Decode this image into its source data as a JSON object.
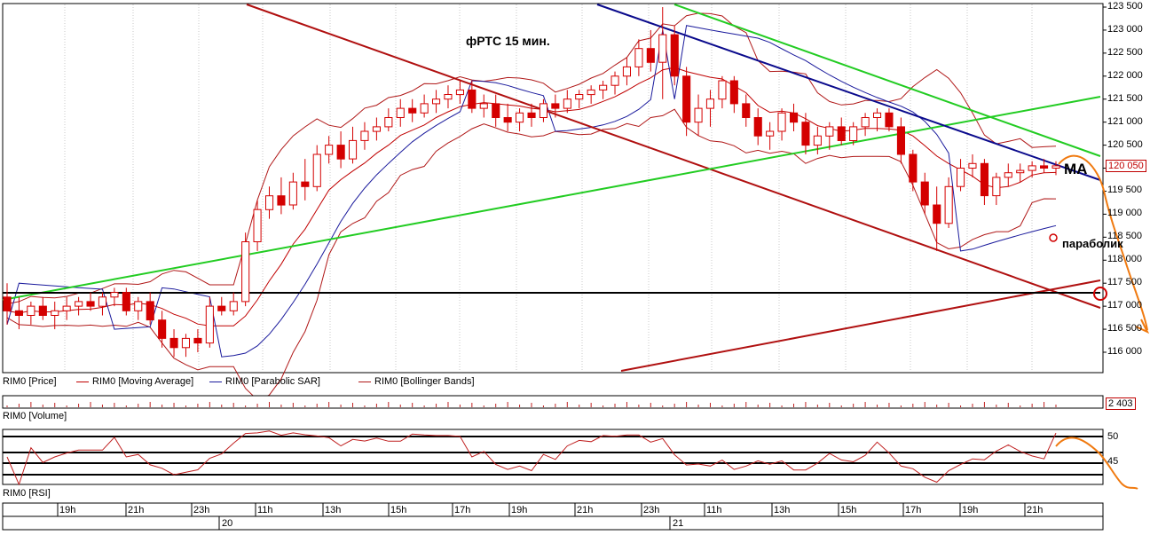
{
  "chart_data": [
    {
      "type": "candlestick",
      "title": "фРТС   15 мин.",
      "instrument": "RIM0",
      "ylim": [
        115600,
        123600
      ],
      "price_ticks": [
        "123 500",
        "123 000",
        "122 500",
        "122 000",
        "121 500",
        "121 000",
        "120 500",
        "120 000",
        "119 500",
        "119 000",
        "118 500",
        "118 000",
        "117 500",
        "117 000",
        "116 500",
        "116 000"
      ],
      "last_price": "120 050",
      "annotations": [
        "MA",
        "параболик"
      ],
      "candles": [
        [
          117200,
          117500,
          116600,
          116900
        ],
        [
          116900,
          117200,
          116500,
          116800
        ],
        [
          116800,
          117100,
          116600,
          117000
        ],
        [
          117000,
          117200,
          116700,
          116800
        ],
        [
          116800,
          117100,
          116500,
          116900
        ],
        [
          116900,
          117200,
          116700,
          117000
        ],
        [
          117000,
          117200,
          116800,
          117100
        ],
        [
          117100,
          117300,
          116900,
          117000
        ],
        [
          117000,
          117300,
          116800,
          117200
        ],
        [
          117200,
          117400,
          117000,
          117300
        ],
        [
          117300,
          117400,
          116800,
          116900
        ],
        [
          116900,
          117200,
          116700,
          117100
        ],
        [
          117100,
          117300,
          116600,
          116700
        ],
        [
          116700,
          116900,
          116100,
          116300
        ],
        [
          116300,
          116500,
          115900,
          116100
        ],
        [
          116100,
          116400,
          115900,
          116300
        ],
        [
          116300,
          116500,
          116000,
          116200
        ],
        [
          116200,
          117200,
          116100,
          117000
        ],
        [
          117000,
          117200,
          116800,
          116900
        ],
        [
          116900,
          117300,
          116800,
          117100
        ],
        [
          117100,
          118600,
          117000,
          118400
        ],
        [
          118400,
          119300,
          118200,
          119100
        ],
        [
          119100,
          119600,
          118900,
          119400
        ],
        [
          119400,
          119800,
          119000,
          119200
        ],
        [
          119200,
          119900,
          119100,
          119700
        ],
        [
          119700,
          120200,
          119300,
          119600
        ],
        [
          119600,
          120500,
          119500,
          120300
        ],
        [
          120300,
          120700,
          120100,
          120500
        ],
        [
          120500,
          120800,
          120000,
          120200
        ],
        [
          120200,
          120900,
          120100,
          120600
        ],
        [
          120600,
          121000,
          120400,
          120800
        ],
        [
          120800,
          121100,
          120600,
          120900
        ],
        [
          120900,
          121300,
          120800,
          121100
        ],
        [
          121100,
          121500,
          120900,
          121300
        ],
        [
          121300,
          121500,
          121000,
          121200
        ],
        [
          121200,
          121600,
          121100,
          121400
        ],
        [
          121400,
          121700,
          121200,
          121500
        ],
        [
          121500,
          121800,
          121300,
          121600
        ],
        [
          121600,
          121900,
          121400,
          121700
        ],
        [
          121700,
          121900,
          121200,
          121300
        ],
        [
          121300,
          121600,
          121100,
          121400
        ],
        [
          121400,
          121600,
          120900,
          121100
        ],
        [
          121100,
          121400,
          120800,
          121000
        ],
        [
          121000,
          121300,
          120800,
          121200
        ],
        [
          121200,
          121400,
          120900,
          121100
        ],
        [
          121100,
          121500,
          121000,
          121400
        ],
        [
          121400,
          121600,
          121100,
          121300
        ],
        [
          121300,
          121700,
          121200,
          121500
        ],
        [
          121500,
          121700,
          121300,
          121600
        ],
        [
          121600,
          121800,
          121400,
          121700
        ],
        [
          121700,
          121900,
          121500,
          121800
        ],
        [
          121800,
          122100,
          121600,
          122000
        ],
        [
          122000,
          122400,
          121800,
          122200
        ],
        [
          122200,
          122800,
          122000,
          122600
        ],
        [
          122600,
          123000,
          122100,
          122300
        ],
        [
          122300,
          123500,
          121500,
          122900
        ],
        [
          122900,
          123100,
          121800,
          122000
        ],
        [
          122000,
          122200,
          120700,
          121000
        ],
        [
          121000,
          121600,
          120700,
          121300
        ],
        [
          121300,
          121700,
          120900,
          121500
        ],
        [
          121500,
          122000,
          121300,
          121900
        ],
        [
          121900,
          122000,
          121200,
          121400
        ],
        [
          121400,
          121600,
          120900,
          121100
        ],
        [
          121100,
          121300,
          120500,
          120700
        ],
        [
          120700,
          121000,
          120400,
          120800
        ],
        [
          120800,
          121300,
          120600,
          121200
        ],
        [
          121200,
          121400,
          120800,
          121000
        ],
        [
          121000,
          121200,
          120300,
          120500
        ],
        [
          120500,
          120900,
          120300,
          120700
        ],
        [
          120700,
          121000,
          120400,
          120900
        ],
        [
          120900,
          121100,
          120500,
          120600
        ],
        [
          120600,
          121000,
          120500,
          120900
        ],
        [
          120900,
          121200,
          120700,
          121100
        ],
        [
          121100,
          121300,
          120800,
          121200
        ],
        [
          121200,
          121300,
          120800,
          120900
        ],
        [
          120900,
          121100,
          120100,
          120300
        ],
        [
          120300,
          120400,
          119500,
          119700
        ],
        [
          119700,
          119900,
          119000,
          119200
        ],
        [
          119200,
          119600,
          118200,
          118800
        ],
        [
          118800,
          119800,
          118700,
          119600
        ],
        [
          119600,
          120200,
          119500,
          120000
        ],
        [
          120000,
          120300,
          119800,
          120100
        ],
        [
          120100,
          120200,
          119200,
          119400
        ],
        [
          119400,
          119900,
          119200,
          119800
        ],
        [
          119800,
          120100,
          119600,
          119900
        ],
        [
          119900,
          120100,
          119700,
          119950
        ],
        [
          119950,
          120150,
          119800,
          120050
        ],
        [
          120050,
          120200,
          119900,
          120000
        ],
        [
          120000,
          120150,
          119850,
          120050
        ]
      ],
      "time_labels": [
        "19h",
        "21h",
        "23h",
        "11h",
        "13h",
        "15h",
        "17h",
        "19h",
        "21h",
        "23h",
        "11h",
        "13h",
        "15h",
        "17h",
        "19h",
        "21h"
      ],
      "date_labels": [
        "20",
        "21"
      ],
      "legend": [
        "RIM0 [Price]",
        "RIM0 [Moving Average]",
        "RIM0 [Parabolic SAR]",
        "RIM0 [Bollinger Bands]"
      ],
      "colors": {
        "candle": "#d40000",
        "ma": "#c00000",
        "sar": "#1a1a9c",
        "bands": "#b01818",
        "green": "#22cc22",
        "blue_line": "#0a0a8c",
        "dark_red_line": "#b01010",
        "arrow": "#f07a10"
      }
    },
    {
      "type": "bar",
      "title": "RIM0 [Volume]",
      "last_value": "2 403"
    },
    {
      "type": "line",
      "title": "RIM0 [RSI]",
      "y_ticks": [
        "50",
        "45"
      ],
      "series_color": "#c02020"
    }
  ]
}
